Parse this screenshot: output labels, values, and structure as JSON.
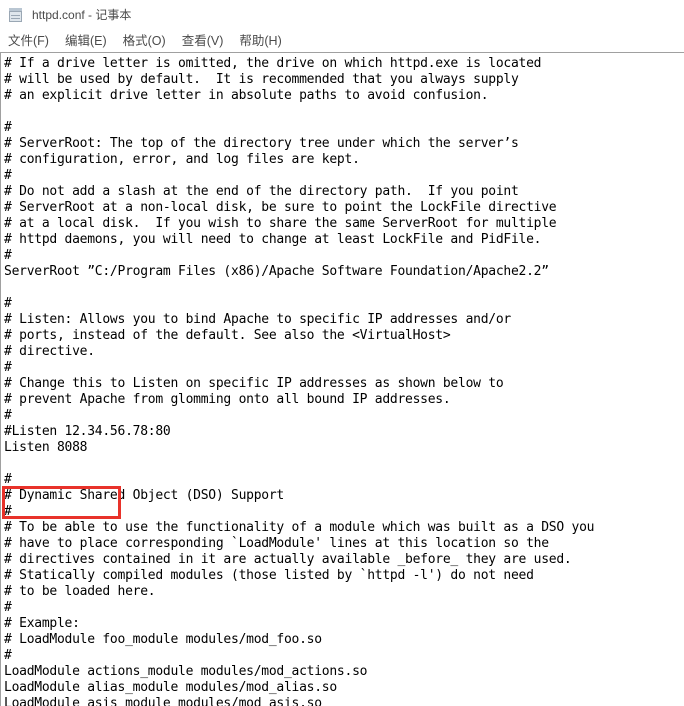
{
  "window": {
    "icon": "notepad-icon",
    "title": "httpd.conf - 记事本"
  },
  "menubar": {
    "items": [
      {
        "label": "文件(F)",
        "name": "menu-file"
      },
      {
        "label": "编辑(E)",
        "name": "menu-edit"
      },
      {
        "label": "格式(O)",
        "name": "menu-format"
      },
      {
        "label": "查看(V)",
        "name": "menu-view"
      },
      {
        "label": "帮助(H)",
        "name": "menu-help"
      }
    ]
  },
  "annotation": {
    "type": "red-rectangle-highlight",
    "color": "#e8322a",
    "target_text": "Listen 8088"
  },
  "editor": {
    "filename": "httpd.conf",
    "lines": [
      "# If a drive letter is omitted, the drive on which httpd.exe is located",
      "# will be used by default.  It is recommended that you always supply",
      "# an explicit drive letter in absolute paths to avoid confusion.",
      "",
      "#",
      "# ServerRoot: The top of the directory tree under which the server’s",
      "# configuration, error, and log files are kept.",
      "#",
      "# Do not add a slash at the end of the directory path.  If you point",
      "# ServerRoot at a non-local disk, be sure to point the LockFile directive",
      "# at a local disk.  If you wish to share the same ServerRoot for multiple",
      "# httpd daemons, you will need to change at least LockFile and PidFile.",
      "#",
      "ServerRoot ”C:/Program Files (x86)/Apache Software Foundation/Apache2.2”",
      "",
      "#",
      "# Listen: Allows you to bind Apache to specific IP addresses and/or",
      "# ports, instead of the default. See also the <VirtualHost>",
      "# directive.",
      "#",
      "# Change this to Listen on specific IP addresses as shown below to",
      "# prevent Apache from glomming onto all bound IP addresses.",
      "#",
      "#Listen 12.34.56.78:80",
      "Listen 8088",
      "",
      "#",
      "# Dynamic Shared Object (DSO) Support",
      "#",
      "# To be able to use the functionality of a module which was built as a DSO you",
      "# have to place corresponding `LoadModule' lines at this location so the",
      "# directives contained in it are actually available _before_ they are used.",
      "# Statically compiled modules (those listed by `httpd -l') do not need",
      "# to be loaded here.",
      "#",
      "# Example:",
      "# LoadModule foo_module modules/mod_foo.so",
      "#",
      "LoadModule actions_module modules/mod_actions.so",
      "LoadModule alias_module modules/mod_alias.so",
      "LoadModule asis_module modules/mod_asis.so"
    ]
  }
}
